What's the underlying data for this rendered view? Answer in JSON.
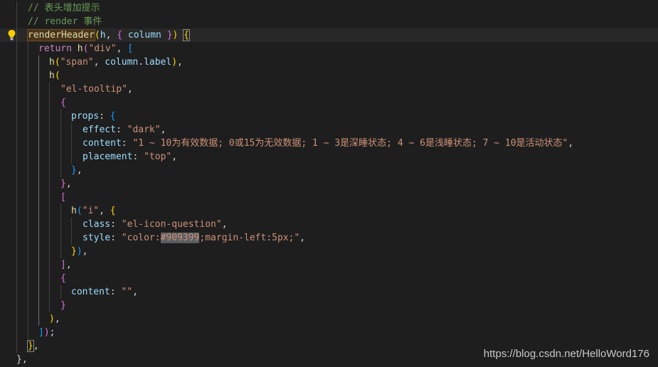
{
  "lines": [
    [
      [
        "t-comment",
        "// 表头增加提示"
      ]
    ],
    [
      [
        "t-comment",
        "// render 事件"
      ]
    ],
    [
      [
        "t-func hl-def",
        "renderHeader"
      ],
      [
        "t-b1",
        "("
      ],
      [
        "t-var",
        "h"
      ],
      [
        "t-punc",
        ", "
      ],
      [
        "t-b2",
        "{"
      ],
      [
        "t-punc",
        " "
      ],
      [
        "t-var",
        "column"
      ],
      [
        "t-punc",
        " "
      ],
      [
        "t-b2",
        "}"
      ],
      [
        "t-b1",
        ")"
      ],
      [
        "t-punc",
        " "
      ],
      [
        "t-b1 hl-match",
        "{"
      ]
    ],
    [
      [
        "t-key",
        "return "
      ],
      [
        "t-func",
        "h"
      ],
      [
        "t-b2",
        "("
      ],
      [
        "t-str",
        "\"div\""
      ],
      [
        "t-punc",
        ", "
      ],
      [
        "t-b3",
        "["
      ]
    ],
    [
      [
        "t-func",
        "h"
      ],
      [
        "t-b1",
        "("
      ],
      [
        "t-str",
        "\"span\""
      ],
      [
        "t-punc",
        ", "
      ],
      [
        "t-var",
        "column"
      ],
      [
        "t-punc",
        "."
      ],
      [
        "t-var",
        "label"
      ],
      [
        "t-b1",
        ")"
      ],
      [
        "t-punc",
        ","
      ]
    ],
    [
      [
        "t-func",
        "h"
      ],
      [
        "t-b1",
        "("
      ]
    ],
    [
      [
        "t-str",
        "\"el-tooltip\""
      ],
      [
        "t-punc",
        ","
      ]
    ],
    [
      [
        "t-b2",
        "{"
      ]
    ],
    [
      [
        "t-var",
        "props"
      ],
      [
        "t-punc",
        ": "
      ],
      [
        "t-b3",
        "{"
      ]
    ],
    [
      [
        "t-var",
        "effect"
      ],
      [
        "t-punc",
        ": "
      ],
      [
        "t-str",
        "\"dark\""
      ],
      [
        "t-punc",
        ","
      ]
    ],
    [
      [
        "t-var",
        "content"
      ],
      [
        "t-punc",
        ": "
      ],
      [
        "t-str",
        "\"1 ~ 10为有效数据; 0或15为无效数据; 1 ~ 3是深睡状态; 4 ~ 6是浅睡状态; 7 ~ 10是活动状态\""
      ],
      [
        "t-punc",
        ","
      ]
    ],
    [
      [
        "t-var",
        "placement"
      ],
      [
        "t-punc",
        ": "
      ],
      [
        "t-str",
        "\"top\""
      ],
      [
        "t-punc",
        ","
      ]
    ],
    [
      [
        "t-b3",
        "}"
      ],
      [
        "t-punc",
        ","
      ]
    ],
    [
      [
        "t-b2",
        "}"
      ],
      [
        "t-punc",
        ","
      ]
    ],
    [
      [
        "t-b2",
        "["
      ]
    ],
    [
      [
        "t-func",
        "h"
      ],
      [
        "t-b3",
        "("
      ],
      [
        "t-str",
        "\"i\""
      ],
      [
        "t-punc",
        ", "
      ],
      [
        "t-b1",
        "{"
      ]
    ],
    [
      [
        "t-var",
        "class"
      ],
      [
        "t-punc",
        ": "
      ],
      [
        "t-str",
        "\"el-icon-question\""
      ],
      [
        "t-punc",
        ","
      ]
    ],
    [
      [
        "t-var",
        "style"
      ],
      [
        "t-punc",
        ": "
      ],
      [
        "t-str",
        "\"color:"
      ],
      [
        "t-str hl-sel",
        "#909399"
      ],
      [
        "t-str",
        ";margin-left:5px;\""
      ],
      [
        "t-punc",
        ","
      ]
    ],
    [
      [
        "t-b1",
        "}"
      ],
      [
        "t-b3",
        ")"
      ],
      [
        "t-punc",
        ","
      ]
    ],
    [
      [
        "t-b2",
        "]"
      ],
      [
        "t-punc",
        ","
      ]
    ],
    [
      [
        "t-b2",
        "{"
      ]
    ],
    [
      [
        "t-var",
        "content"
      ],
      [
        "t-punc",
        ": "
      ],
      [
        "t-str",
        "\"\""
      ],
      [
        "t-punc",
        ","
      ]
    ],
    [
      [
        "t-b2",
        "}"
      ]
    ],
    [
      [
        "t-b1",
        ")"
      ],
      [
        "t-punc",
        ","
      ]
    ],
    [
      [
        "t-b3",
        "]"
      ],
      [
        "t-b2",
        ")"
      ],
      [
        "t-punc",
        ";"
      ]
    ],
    [
      [
        "t-b1 hl-match",
        "}"
      ],
      [
        "t-punc",
        ","
      ]
    ],
    [
      [
        "t-punc",
        "},"
      ]
    ]
  ],
  "watermark": "https://blog.csdn.net/HelloWord176",
  "colors": {
    "background": "#1e1e1e",
    "comment": "#6a9955",
    "function": "#dcdcaa",
    "variable": "#9cdcfe",
    "keyword": "#c586c0",
    "string": "#ce9178",
    "bracket_gold": "#ffd700",
    "bracket_orchid": "#da70d6",
    "bracket_blue": "#179fff"
  },
  "icons": {
    "gutter": "lightbulb-icon"
  }
}
